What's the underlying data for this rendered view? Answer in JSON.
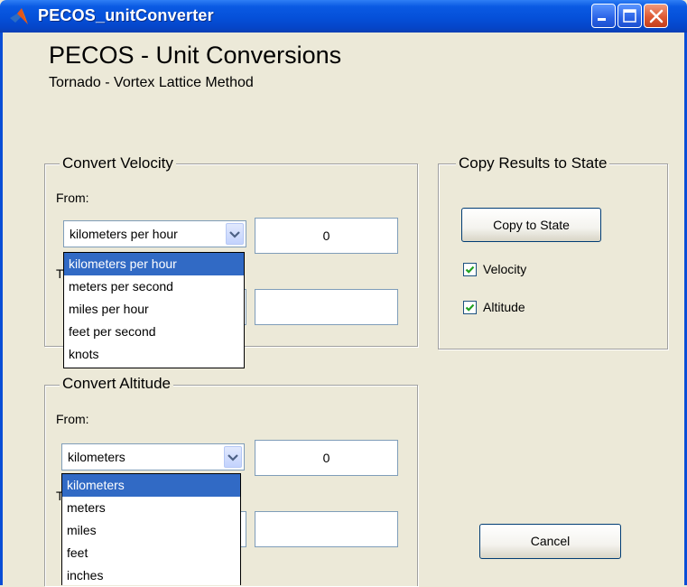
{
  "window": {
    "title": "PECOS_unitConverter"
  },
  "header": {
    "title": "PECOS - Unit Conversions",
    "subtitle": "Tornado - Vortex Lattice Method"
  },
  "velocity": {
    "group_title": "Convert Velocity",
    "from_label": "From:",
    "to_label_partial": "T",
    "from_selected": "kilometers per hour",
    "from_value": "0",
    "to_value": "",
    "options": [
      "kilometers per hour",
      "meters per second",
      "miles per hour",
      "feet per second",
      "knots"
    ]
  },
  "altitude": {
    "group_title": "Convert Altitude",
    "from_label": "From:",
    "to_label_partial": "T",
    "from_selected": "kilometers",
    "from_value": "0",
    "to_value": "",
    "options": [
      "kilometers",
      "meters",
      "miles",
      "feet",
      "inches"
    ]
  },
  "copy": {
    "group_title": "Copy Results to State",
    "button_label": "Copy to State",
    "velocity_label": "Velocity",
    "velocity_checked": true,
    "altitude_label": "Altitude",
    "altitude_checked": true
  },
  "cancel_label": "Cancel",
  "icons": {
    "app": "matlab-logo-icon",
    "minimize": "minimize-icon",
    "maximize": "maximize-icon",
    "close": "close-icon",
    "dropdown": "chevron-down-icon",
    "check": "check-icon"
  },
  "colors": {
    "titlebar": "#0550d9",
    "selection": "#316ac5",
    "background": "#ece9d8"
  }
}
